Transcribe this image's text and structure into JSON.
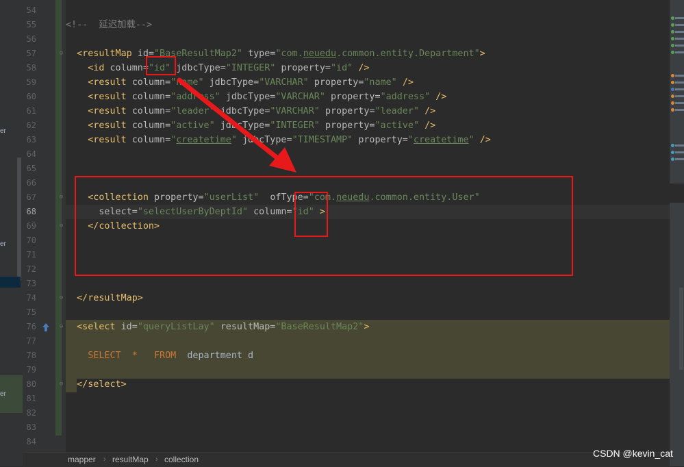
{
  "editor": {
    "lines": [
      {
        "num": "54",
        "html": ""
      },
      {
        "num": "55",
        "html": "<span class=\"cmt\">&lt;!--  延迟加载--&gt;</span>"
      },
      {
        "num": "56",
        "html": ""
      },
      {
        "num": "57",
        "html": "  <span class=\"tag\">&lt;resultMap </span><span class=\"attr\">id=</span><span class=\"val\">\"BaseResultMap2\"</span> <span class=\"attr\">type=</span><span class=\"val\">\"com.<span class=\"und\">neuedu</span>.common.entity.Department\"</span><span class=\"tag\">&gt;</span>"
      },
      {
        "num": "58",
        "html": "    <span class=\"tag\">&lt;id </span><span class=\"attr\">column=</span><span class=\"val\">\"id\"</span> <span class=\"attr\">jdbcType=</span><span class=\"val\">\"INTEGER\"</span> <span class=\"attr\">property=</span><span class=\"val\">\"id\"</span> <span class=\"tag\">/&gt;</span>"
      },
      {
        "num": "59",
        "html": "    <span class=\"tag\">&lt;result </span><span class=\"attr\">column=</span><span class=\"val\">\"name\"</span> <span class=\"attr\">jdbcType=</span><span class=\"val\">\"VARCHAR\"</span> <span class=\"attr\">property=</span><span class=\"val\">\"name\"</span> <span class=\"tag\">/&gt;</span>"
      },
      {
        "num": "60",
        "html": "    <span class=\"tag\">&lt;result </span><span class=\"attr\">column=</span><span class=\"val\">\"address\"</span> <span class=\"attr\">jdbcType=</span><span class=\"val\">\"VARCHAR\"</span> <span class=\"attr\">property=</span><span class=\"val\">\"address\"</span> <span class=\"tag\">/&gt;</span>"
      },
      {
        "num": "61",
        "html": "    <span class=\"tag\">&lt;result </span><span class=\"attr\">column=</span><span class=\"val\">\"leader\"</span> <span class=\"attr\">jdbcType=</span><span class=\"val\">\"VARCHAR\"</span> <span class=\"attr\">property=</span><span class=\"val\">\"leader\"</span> <span class=\"tag\">/&gt;</span>"
      },
      {
        "num": "62",
        "html": "    <span class=\"tag\">&lt;result </span><span class=\"attr\">column=</span><span class=\"val\">\"active\"</span> <span class=\"attr\">jdbcType=</span><span class=\"val\">\"INTEGER\"</span> <span class=\"attr\">property=</span><span class=\"val\">\"active\"</span> <span class=\"tag\">/&gt;</span>"
      },
      {
        "num": "63",
        "html": "    <span class=\"tag\">&lt;result </span><span class=\"attr\">column=</span><span class=\"val\">\"<span class=\"und\">createtime</span>\"</span> <span class=\"attr\">jdbcType=</span><span class=\"val\">\"TIMESTAMP\"</span> <span class=\"attr\">property=</span><span class=\"val\">\"<span class=\"und\">createtime</span>\"</span> <span class=\"tag\">/&gt;</span>"
      },
      {
        "num": "64",
        "html": ""
      },
      {
        "num": "65",
        "html": ""
      },
      {
        "num": "66",
        "html": ""
      },
      {
        "num": "67",
        "html": "    <span class=\"tag\">&lt;collection </span><span class=\"attr\">property=</span><span class=\"val\">\"userList\"</span>  <span class=\"attr\">ofType=</span><span class=\"val\">\"com.<span class=\"und\">neuedu</span>.common.entity.User\"</span>"
      },
      {
        "num": "68",
        "html": "      <span class=\"attr\">select=</span><span class=\"val\">\"selectUserByDeptId\"</span> <span class=\"attr\">column=</span><span class=\"val\">\"id\"</span> <span class=\"tag\">&gt;</span>"
      },
      {
        "num": "69",
        "html": "    <span class=\"tag\">&lt;/collection&gt;</span>"
      },
      {
        "num": "70",
        "html": ""
      },
      {
        "num": "71",
        "html": ""
      },
      {
        "num": "72",
        "html": ""
      },
      {
        "num": "73",
        "html": ""
      },
      {
        "num": "74",
        "html": "  <span class=\"tag\">&lt;/resultMap&gt;</span>"
      },
      {
        "num": "75",
        "html": ""
      },
      {
        "num": "76",
        "html": "  <span class=\"tag\">&lt;select </span><span class=\"attr\">id=</span><span class=\"val\">\"queryListLay\"</span> <span class=\"attr\">resultMap=</span><span class=\"val\">\"BaseResultMap2\"</span><span class=\"tag\">&gt;</span>"
      },
      {
        "num": "77",
        "html": ""
      },
      {
        "num": "78",
        "html": "    <span class=\"kw\">SELECT</span>  <span class=\"kw\">*</span>   <span class=\"kw\">FROM</span>  department d"
      },
      {
        "num": "79",
        "html": ""
      },
      {
        "num": "80",
        "html": "  <span class=\"tag\">&lt;/select&gt;</span>"
      },
      {
        "num": "81",
        "html": ""
      },
      {
        "num": "82",
        "html": ""
      },
      {
        "num": "83",
        "html": ""
      },
      {
        "num": "84",
        "html": ""
      }
    ],
    "current_line": "68"
  },
  "breadcrumb": {
    "items": [
      "mapper",
      "resultMap",
      "collection"
    ],
    "separator": "›"
  },
  "left_panel": {
    "labels": [
      "er",
      "er",
      "er"
    ]
  },
  "watermark": "CSDN @kevin_cat",
  "colors": {
    "annotation": "#e8191b",
    "tag": "#e8bf6a",
    "string": "#6a8759",
    "keyword": "#cc7832"
  }
}
